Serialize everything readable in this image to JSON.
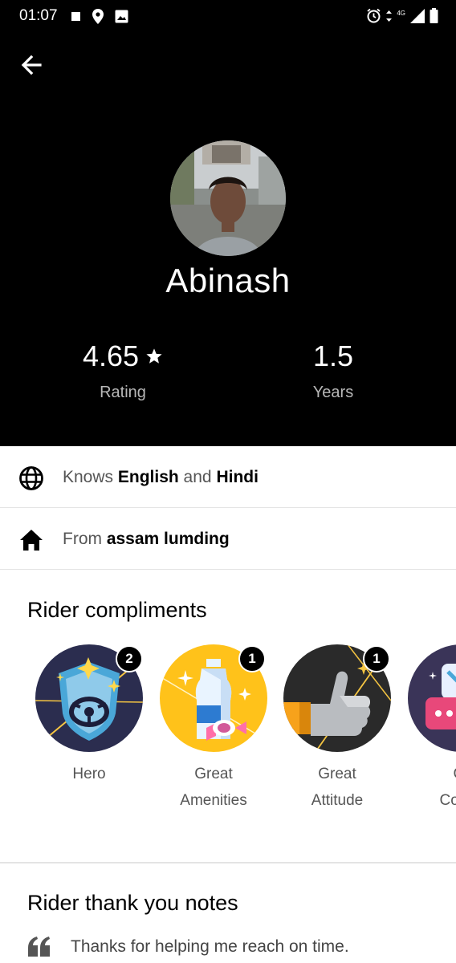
{
  "status_bar": {
    "time": "01:07",
    "network": "4G",
    "icons": [
      "square-notification-icon",
      "location-icon",
      "image-icon",
      "alarm-icon",
      "data-arrows-icon",
      "signal-icon",
      "battery-icon"
    ]
  },
  "header": {
    "back_icon": "back-arrow-icon",
    "driver_name": "Abinash",
    "rating_value": "4.65",
    "rating_icon": "star-icon",
    "rating_label": "Rating",
    "years_value": "1.5",
    "years_label": "Years"
  },
  "languages": {
    "icon": "globe-icon",
    "prefix": "Knows ",
    "lang1": "English",
    "joiner": " and ",
    "lang2": "Hindi"
  },
  "hometown": {
    "icon": "home-icon",
    "prefix": "From ",
    "place": "assam lumding"
  },
  "compliments": {
    "title": "Rider compliments",
    "items": [
      {
        "line1": "Hero",
        "line2": "",
        "count": "2",
        "icon": "hero-shield-icon"
      },
      {
        "line1": "Great",
        "line2": "Amenities",
        "count": "1",
        "icon": "water-bottle-candy-icon"
      },
      {
        "line1": "Great",
        "line2": "Attitude",
        "count": "1",
        "icon": "thumbs-up-icon"
      },
      {
        "line1": "Gr",
        "line2": "Conve",
        "count": "",
        "icon": "chat-bubble-icon"
      }
    ]
  },
  "notes": {
    "title": "Rider thank you notes",
    "quote_icon": "quote-icon",
    "first_note": "Thanks for helping me reach on time."
  },
  "colors": {
    "header_bg": "#000000",
    "divider": "#e4e4e4",
    "hero_bg": "#2b2d4f",
    "amenities_bg": "#ffc21a",
    "attitude_bg": "#2a2a2a"
  }
}
